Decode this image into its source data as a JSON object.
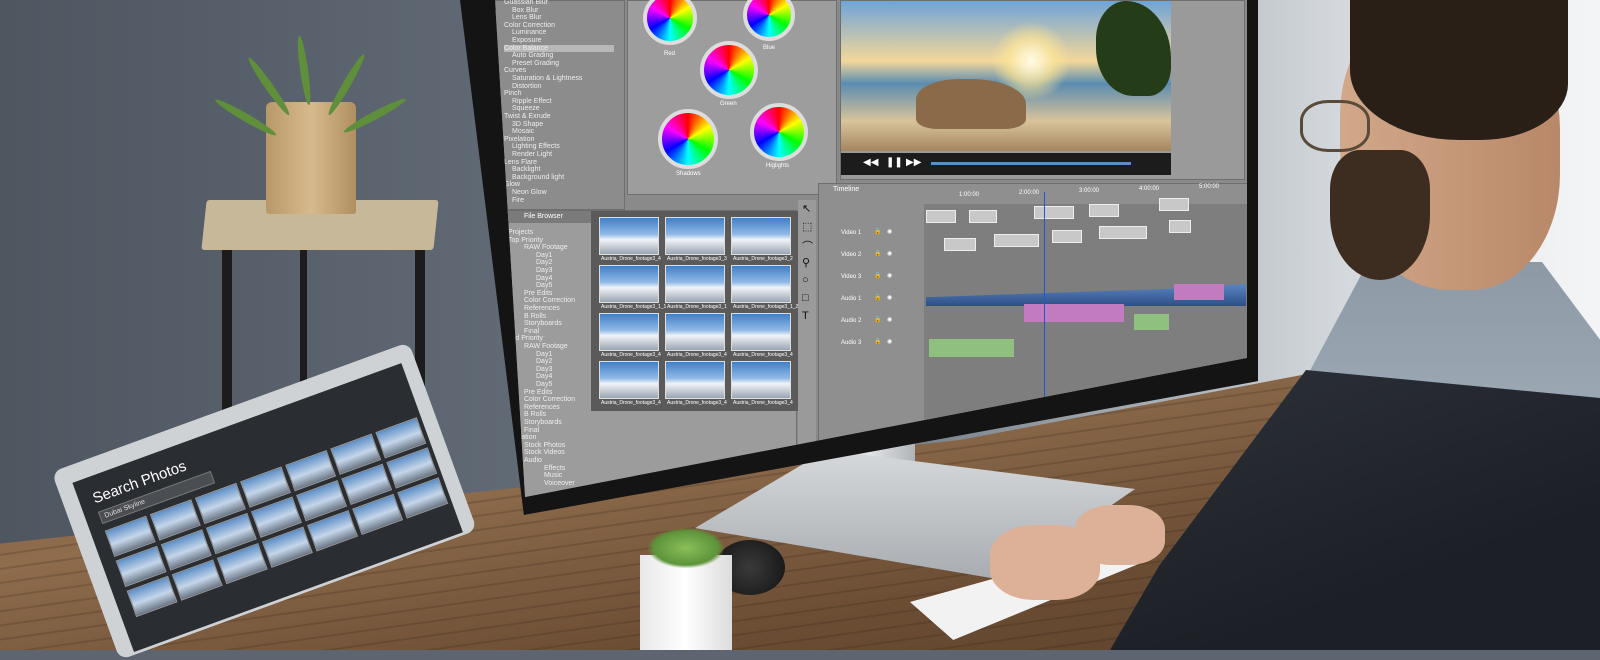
{
  "effects_list": [
    "Guassian Blur",
    "Box Blur",
    "Lens Blur",
    "Color Correction",
    "Luminance",
    "Exposure",
    "Color Balance",
    "Auto Grading",
    "Preset Grading",
    "Curves",
    "Saturation & Lightness",
    "Distortion",
    "Pinch",
    "Ripple Effect",
    "Squeeze",
    "Twist & Exrude",
    "3D Shape",
    "Mosaic",
    "Pixelation",
    "Lighting Effects",
    "Render Light",
    "Lens Flare",
    "Backlight",
    "Background light",
    "Glow",
    "Neon Glow",
    "Fire"
  ],
  "color_wheels": [
    "Red",
    "Blue",
    "Green",
    "Shadows",
    "Higlights"
  ],
  "file_browser": {
    "title": "File Browser",
    "tree": [
      "Projects",
      "Top Priority",
      "RAW Footage",
      "Day1",
      "Day2",
      "Day3",
      "Day4",
      "Day5",
      "Pre Edits",
      "Color Correction",
      "References",
      "B Rolls",
      "Storyboards",
      "Final",
      "Mid Priority",
      "RAW Footage",
      "Day1",
      "Day2",
      "Day3",
      "Day4",
      "Day5",
      "Pre Edits",
      "Color Correction",
      "References",
      "B Rolls",
      "Storyboards",
      "Final",
      "Insiration",
      "Stock Photos",
      "Stock Videos",
      "Audio",
      "Effects",
      "Music",
      "Voiceover"
    ],
    "thumbnails": [
      "Austria_Drone_footage3_4",
      "Austria_Drone_footage3_3",
      "Austria_Drone_footage3_2",
      "Austria_Drone_footage3_1_1",
      "Austria_Drone_footage3_1",
      "Austria_Drone_footage3_1_2",
      "Austria_Drone_footage3_4",
      "Austria_Drone_footage3_4",
      "Austria_Drone_footage3_4",
      "Austria_Drone_footage3_4",
      "Austria_Drone_footage3_4",
      "Austria_Drone_footage3_4"
    ]
  },
  "timeline": {
    "title": "Timeline",
    "timecodes": [
      "1:00:00",
      "2:00:00",
      "3:00:00",
      "4:00:00",
      "5:00:00"
    ],
    "tracks": [
      "Video 1",
      "Video 2",
      "Video 3",
      "Audio 1",
      "Audio 2",
      "Audio 3"
    ]
  },
  "tablet": {
    "title": "Search Photos",
    "search_value": "Dubai Skyline"
  }
}
